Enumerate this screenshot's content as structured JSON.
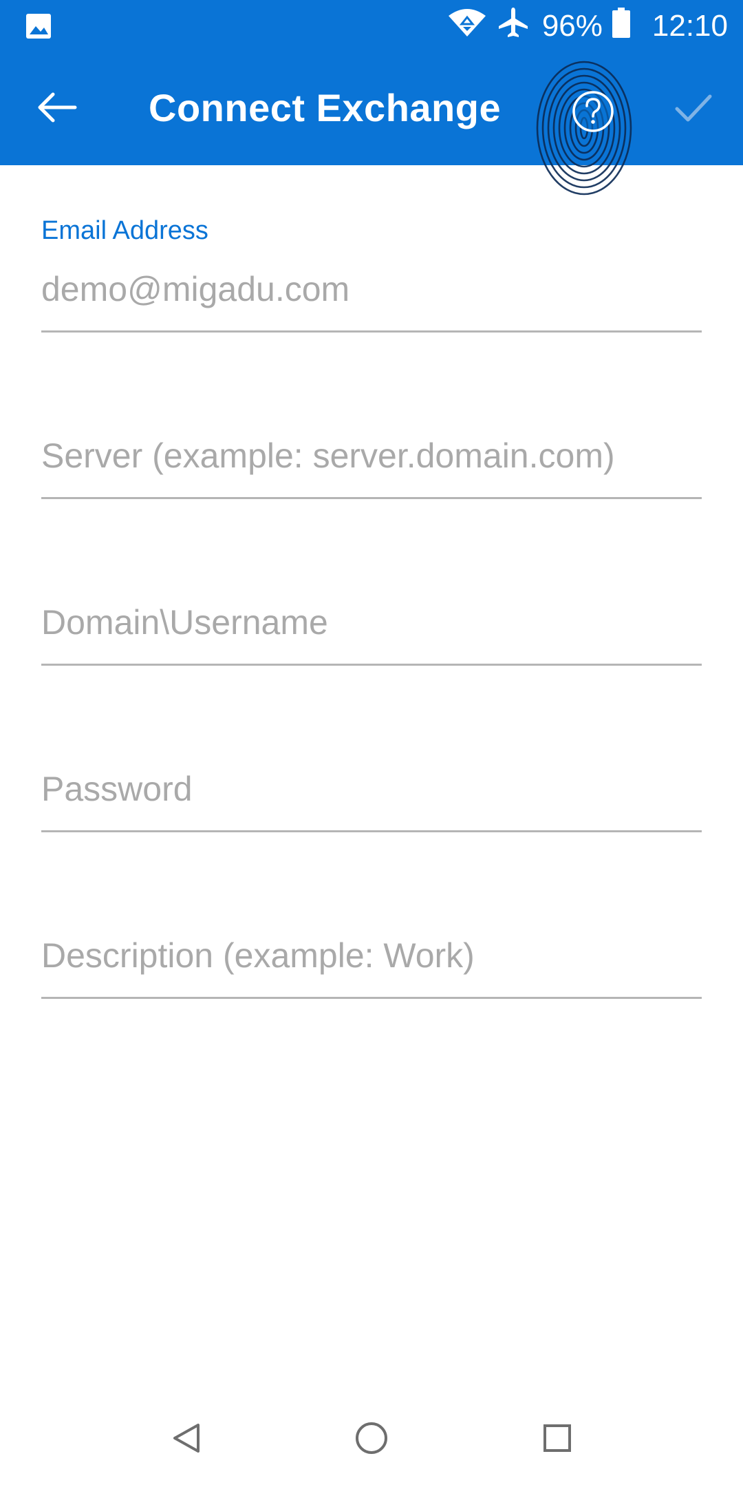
{
  "status_bar": {
    "battery_percent": "96%",
    "time": "12:10",
    "icons": [
      "gallery-icon",
      "wifi-icon",
      "airplane-mode-icon",
      "battery-icon"
    ]
  },
  "toolbar": {
    "title": "Connect Exchange",
    "icons": [
      "back-arrow-icon",
      "help-icon",
      "check-icon"
    ]
  },
  "form": {
    "email": {
      "label": "Email Address",
      "placeholder": "demo@migadu.com"
    },
    "server": {
      "placeholder": "Server (example: server.domain.com)"
    },
    "username": {
      "placeholder": "Domain\\Username"
    },
    "password": {
      "placeholder": "Password"
    },
    "description": {
      "placeholder": "Description (example: Work)"
    }
  },
  "nav_bar": {
    "icons": [
      "nav-back-icon",
      "nav-home-icon",
      "nav-recents-icon"
    ]
  },
  "colors": {
    "accent": "#0a74d6",
    "placeholder": "#a9a9a9",
    "divider": "#b5b5b5",
    "check_disabled": "#7fb3e6"
  }
}
